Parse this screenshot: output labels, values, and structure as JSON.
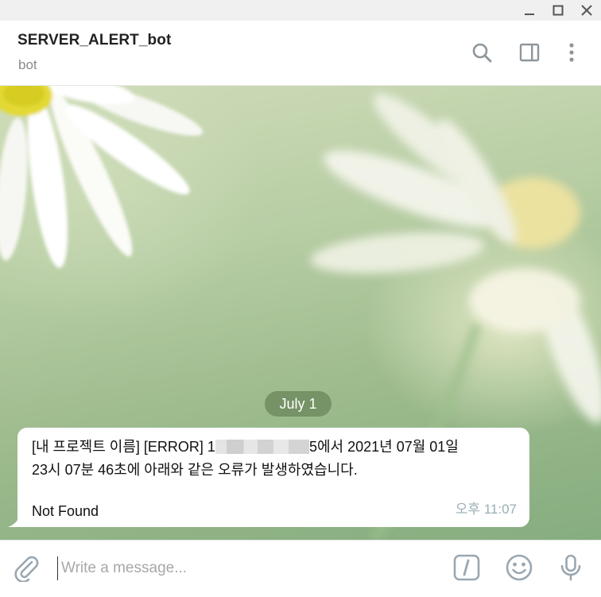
{
  "window": {
    "controls": [
      "minimize-icon",
      "maximize-icon",
      "close-icon"
    ]
  },
  "header": {
    "title": "SERVER_ALERT_bot",
    "subtitle": "bot",
    "icons": [
      "search-icon",
      "sidebar-toggle-icon",
      "more-vertical-icon"
    ]
  },
  "chat": {
    "date_pill": "July 1",
    "message": {
      "line1_prefix": "[내 프로젝트 이름] [ERROR] 1",
      "line1_suffix": "5에서 2021년 07월 01일",
      "line2": "23시 07분 46초에 아래와 같은 오류가 발생하였습니다.",
      "line3": "Not Found",
      "time": "오후 11:07"
    }
  },
  "composer": {
    "placeholder": "Write a message...",
    "value": "",
    "icons": [
      "attach-icon",
      "commands-icon",
      "emoji-icon",
      "microphone-icon"
    ]
  },
  "colors": {
    "accent_icon": "#9aa7b0",
    "time_text": "#9aaeb5",
    "date_pill_bg": "#6e8c5f"
  }
}
